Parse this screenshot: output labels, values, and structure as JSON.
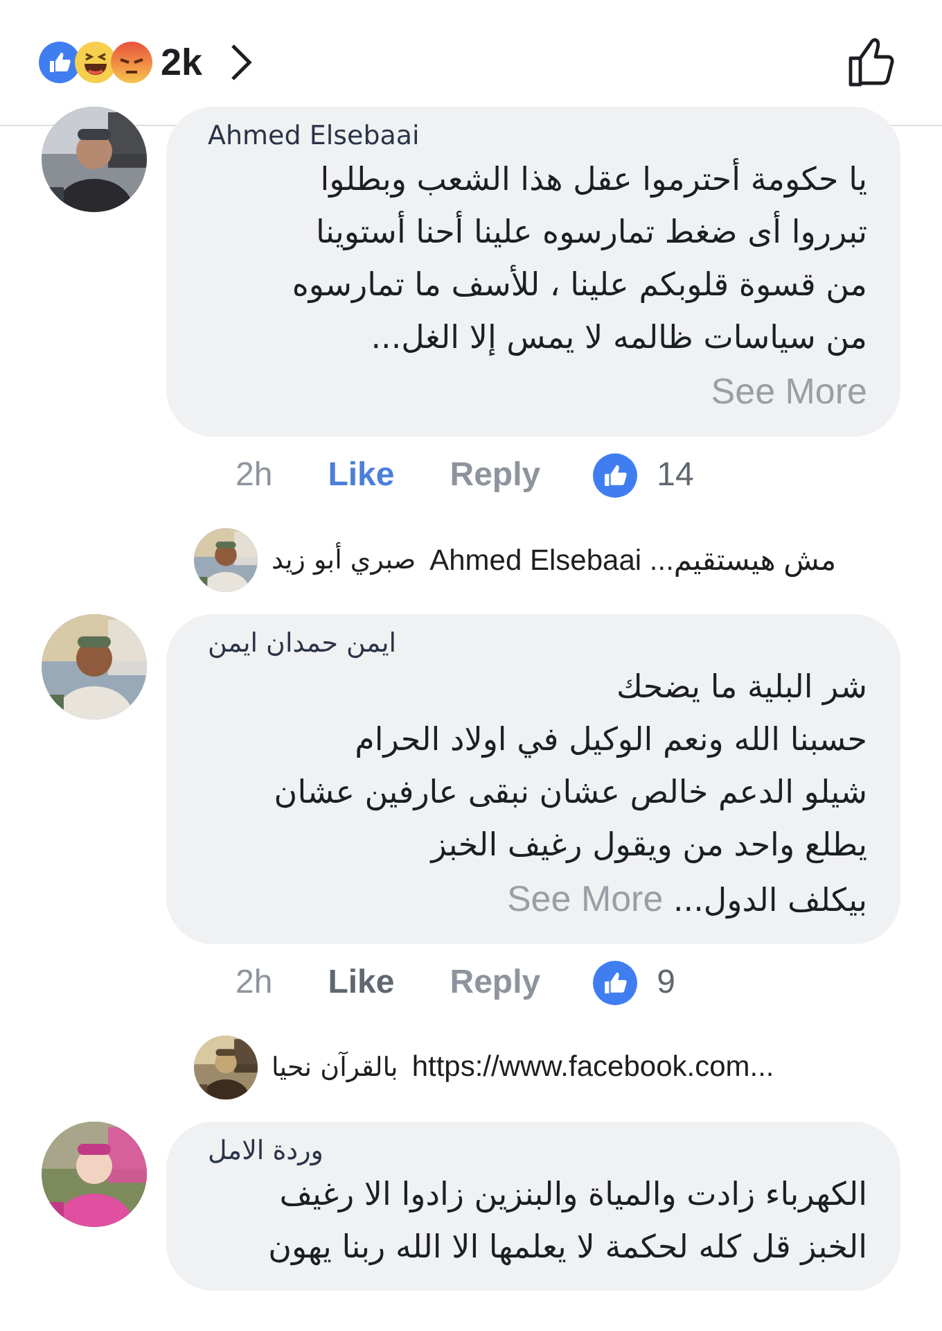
{
  "reactions_bar": {
    "count": "2k"
  },
  "comments": [
    {
      "author": "Ahmed Elsebaai",
      "lines": [
        "يا حكومة أحترموا عقل هذا الشعب وبطلوا",
        "تبرروا أى ضغط تمارسوه علينا أحنا أستوينا",
        "من قسوة قلوبكم علينا ، للأسف ما تمارسوه",
        "من سياسات ظالمه لا يمس إلا الغل..."
      ],
      "see_more": "See More",
      "time": "2h",
      "like": {
        "label": "Like",
        "selected": true
      },
      "reply": "Reply",
      "reaction_count": "14",
      "reply_preview": {
        "author": "صبري أبو زيد",
        "text": "مش هيستقيم... Ahmed Elsebaai"
      }
    },
    {
      "author": "ايمن حمدان ايمن",
      "lines": [
        "شر البلية ما يضحك",
        "حسبنا الله ونعم الوكيل في اولاد الحرام",
        "شيلو الدعم خالص  عشان نبقى عارفين  عشان",
        "يطلع واحد من              ويقول رغيف الخبز",
        "بيكلف الدول..."
      ],
      "see_more": "See More",
      "time": "2h",
      "like": {
        "label": "Like",
        "selected": false
      },
      "reply": "Reply",
      "reaction_count": "9",
      "reply_preview": {
        "author": "بالقرآن نحيا",
        "text": "https://www.facebook.com..."
      }
    },
    {
      "author": "وردة الامل",
      "lines": [
        "الكهرباء زادت والمياة والبنزين زادوا الا رغيف",
        "الخبز قل كله لحكمة لا يعلمها الا الله ربنا يهون"
      ]
    }
  ]
}
